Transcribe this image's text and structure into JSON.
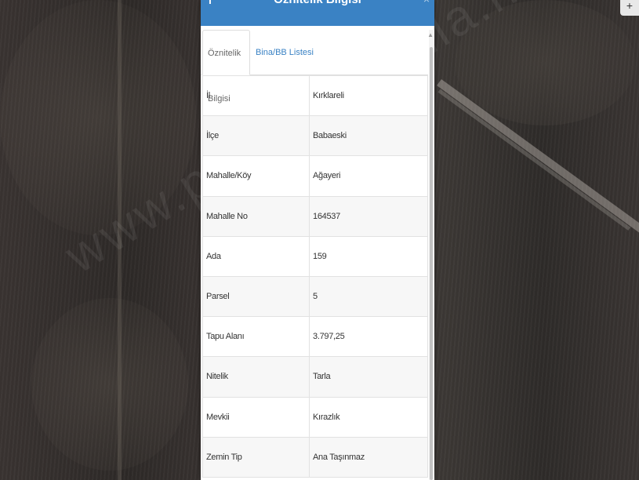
{
  "panel": {
    "title": "Öznitelik Bilgisi",
    "header_icon": "info-icon",
    "close_icon": "close-icon"
  },
  "tabs": [
    {
      "label": "Öznitelik Bilgisi",
      "active": true
    },
    {
      "label": "Bina/BB Listesi",
      "active": false
    }
  ],
  "attributes": [
    {
      "key": "İl",
      "value": "Kırklareli"
    },
    {
      "key": "İlçe",
      "value": "Babaeski"
    },
    {
      "key": "Mahalle/Köy",
      "value": "Ağayeri"
    },
    {
      "key": "Mahalle No",
      "value": "164537"
    },
    {
      "key": "Ada",
      "value": "159"
    },
    {
      "key": "Parsel",
      "value": "5"
    },
    {
      "key": "Tapu Alanı",
      "value": "3.797,25"
    },
    {
      "key": "Nitelik",
      "value": "Tarla"
    },
    {
      "key": "Mevkii",
      "value": "Kırazlık"
    },
    {
      "key": "Zemin Tip",
      "value": "Ana Taşınmaz"
    }
  ],
  "watermark": "www.parselsorgula.net",
  "colors": {
    "header": "#3a82c4",
    "tab_link": "#3a82c4"
  }
}
